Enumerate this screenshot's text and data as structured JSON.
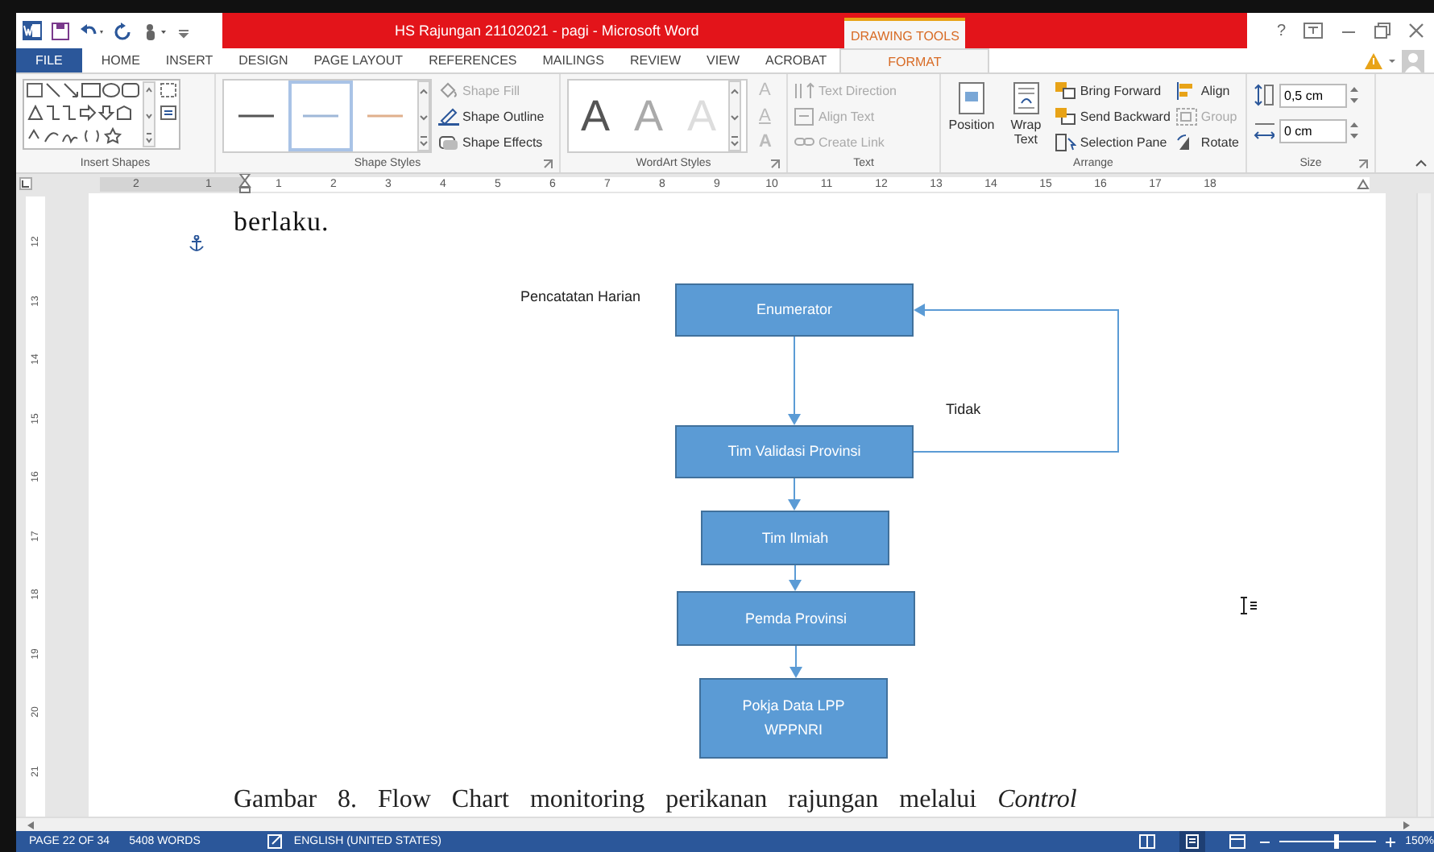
{
  "title_bar": {
    "title": "HS Rajungan 21102021 - pagi -  Microsoft Word",
    "context_tab": "DRAWING TOOLS",
    "help": "?"
  },
  "tabs": [
    {
      "label": "FILE",
      "kind": "file",
      "selected": false
    },
    {
      "label": "HOME",
      "kind": "tab",
      "selected": false
    },
    {
      "label": "INSERT",
      "kind": "tab",
      "selected": false
    },
    {
      "label": "DESIGN",
      "kind": "tab",
      "selected": false
    },
    {
      "label": "PAGE LAYOUT",
      "kind": "tab",
      "selected": false
    },
    {
      "label": "REFERENCES",
      "kind": "tab",
      "selected": false
    },
    {
      "label": "MAILINGS",
      "kind": "tab",
      "selected": false
    },
    {
      "label": "REVIEW",
      "kind": "tab",
      "selected": false
    },
    {
      "label": "VIEW",
      "kind": "tab",
      "selected": false
    },
    {
      "label": "ACROBAT",
      "kind": "tab",
      "selected": false
    },
    {
      "label": "FORMAT",
      "kind": "context",
      "selected": true
    }
  ],
  "ribbon": {
    "insert_shapes": {
      "label": "Insert Shapes"
    },
    "shape_styles": {
      "label": "Shape Styles",
      "commands": [
        {
          "label": "Shape Fill",
          "disabled": true
        },
        {
          "label": "Shape Outline",
          "disabled": false
        },
        {
          "label": "Shape Effects",
          "disabled": false
        }
      ]
    },
    "wordart_styles": {
      "label": "WordArt Styles",
      "samples": [
        "A",
        "A",
        "A"
      ],
      "text_tools": [
        {
          "label": "A",
          "disabled": true
        },
        {
          "label": "A",
          "disabled": true
        },
        {
          "label": "A",
          "disabled": true
        }
      ]
    },
    "text": {
      "label": "Text",
      "commands": [
        {
          "label": "Text Direction",
          "disabled": true
        },
        {
          "label": "Align Text",
          "disabled": true
        },
        {
          "label": "Create Link",
          "disabled": true
        }
      ]
    },
    "arrange": {
      "label": "Arrange",
      "large": [
        "Position",
        "Wrap Text"
      ],
      "commands": [
        {
          "label": "Bring Forward",
          "disabled": false
        },
        {
          "label": "Send Backward",
          "disabled": false
        },
        {
          "label": "Selection Pane",
          "disabled": false
        }
      ],
      "commands_2": [
        {
          "label": "Align",
          "disabled": false
        },
        {
          "label": "Group",
          "disabled": true
        },
        {
          "label": "Rotate",
          "disabled": false
        }
      ]
    },
    "size": {
      "label": "Size",
      "fields": [
        "0,5 cm",
        "0 cm"
      ]
    }
  },
  "ruler": {
    "marks": [
      "2",
      "1",
      "1",
      "2",
      "3",
      "4",
      "5",
      "6",
      "7",
      "8",
      "9",
      "10",
      "11",
      "12",
      "13",
      "14",
      "15",
      "16",
      "17",
      "18"
    ]
  },
  "vertical_ruler": {
    "marks": [
      "12",
      "13",
      "14",
      "15",
      "16",
      "17",
      "18",
      "19",
      "20",
      "21"
    ]
  },
  "document": {
    "paragraph": "berlaku.",
    "flowchart": {
      "nodes": [
        "Enumerator",
        "Tim Validasi Provinsi",
        "Tim Ilmiah",
        "Pemda Provinsi",
        "Pokja Data LPP WPPNRI"
      ],
      "labels": [
        "Pencatatan Harian",
        "Tidak"
      ],
      "edges": [
        {
          "kind": "straight"
        },
        {
          "kind": "straight"
        },
        {
          "kind": "straight"
        },
        {
          "kind": "straight"
        },
        {
          "kind": "loop"
        }
      ]
    },
    "caption": "Gambar 8. Flow Chart monitoring perikanan rajungan melalui *Control*"
  },
  "status_bar": {
    "page": "PAGE 22 OF 34",
    "words": "5408 WORDS",
    "language": "ENGLISH (UNITED STATES)",
    "views": [
      {
        "kind": "read",
        "selected": false
      },
      {
        "kind": "print",
        "selected": true
      },
      {
        "kind": "web",
        "selected": false
      }
    ],
    "zoom_level": {
      "level": 0.58
    },
    "zoom": "150%"
  }
}
